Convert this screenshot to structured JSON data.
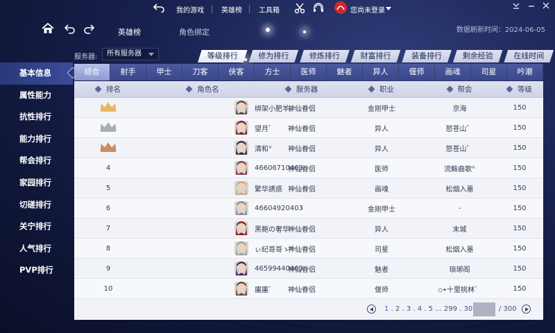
{
  "topbar": {
    "nav": [
      "我的游戏",
      "英雄榜",
      "工具箱"
    ],
    "user_label": "您尚未登录"
  },
  "header": {
    "tabs": [
      "英雄榜",
      "角色绑定"
    ],
    "data_time": "数据刷新时间：2024-06-05"
  },
  "sidebar": {
    "items": [
      "基本信息",
      "属性能力",
      "抗性排行",
      "能力排行",
      "帮会排行",
      "家园排行",
      "切磋排行",
      "关宁排行",
      "人气排行",
      "PVP排行"
    ],
    "active_index": 0
  },
  "server": {
    "label": "服务器:",
    "value": "所有服务器"
  },
  "rank_tabs": [
    "等级排行",
    "修为排行",
    "修炼排行",
    "财富排行",
    "装备排行",
    "剩余经验",
    "在线时间"
  ],
  "class_tabs": [
    "综合",
    "射手",
    "甲士",
    "刀客",
    "侠客",
    "方士",
    "医师",
    "魅者",
    "异人",
    "偃师",
    "画魂",
    "司星",
    "吟潮"
  ],
  "table": {
    "headers": [
      "排名",
      "角色名",
      "服务器",
      "职业",
      "帮会",
      "等级"
    ],
    "rows": [
      {
        "rank": "1",
        "crown": "gold",
        "name": "绑架小肥羊。",
        "server": "神仙眷侣",
        "job": "金刚甲士",
        "guild": "京海",
        "level": "150",
        "avatar": "#5c4a45"
      },
      {
        "rank": "2",
        "crown": "silver",
        "name": "望月゛",
        "server": "神仙眷侣",
        "job": "异人",
        "guild": "怒苍山゛",
        "level": "150",
        "avatar": "#7a1f24"
      },
      {
        "rank": "3",
        "crown": "bronze",
        "name": "清和°",
        "server": "神仙眷侣",
        "job": "异人",
        "guild": "怒苍山゛",
        "level": "150",
        "avatar": "#3b2730"
      },
      {
        "rank": "4",
        "crown": "",
        "name": "46606710403",
        "server": "神仙眷侣",
        "job": "医师",
        "guild": "流觞曲歌°",
        "level": "150",
        "avatar": "#8a3a4a"
      },
      {
        "rank": "5",
        "crown": "",
        "name": "繁华誘惑",
        "server": "神仙眷侣",
        "job": "画魂",
        "guild": "松烟入墨",
        "level": "150",
        "avatar": "#c9a88a"
      },
      {
        "rank": "6",
        "crown": "",
        "name": "46604920403",
        "server": "-",
        "job": "金刚甲士",
        "guild": "-",
        "level": "150",
        "avatar": "#8c8a8f"
      },
      {
        "rank": "7",
        "crown": "",
        "name": "黑鲍の奢华",
        "server": "神仙眷侣",
        "job": "异人",
        "guild": "末城",
        "level": "150",
        "avatar": "#8a1d22"
      },
      {
        "rank": "8",
        "crown": "",
        "name": "ぃ纪哥哥ゝ°",
        "server": "神仙眷侣",
        "job": "司星",
        "guild": "松烟入墨",
        "level": "150",
        "avatar": "#9aa39b"
      },
      {
        "rank": "9",
        "crown": "",
        "name": "46599440403",
        "server": "神仙眷侣",
        "job": "魅者",
        "guild": "琅琊阁",
        "level": "150",
        "avatar": "#4b2450"
      },
      {
        "rank": "10",
        "crown": "",
        "name": "廛廛゛",
        "server": "神仙眷侣",
        "job": "偃师",
        "guild": "⬦•十里桃林゛",
        "level": "150",
        "avatar": "#6b4a3a"
      }
    ]
  },
  "pager": {
    "current": "1",
    "rest": ". 2 . 3 . 4 . 5 ... 299 . 300",
    "total": "/ 300"
  },
  "colors": {
    "bg": "#1a2352",
    "accent": "#3e4c8c",
    "gold": "#e6b76a",
    "silver": "#a9adba",
    "bronze": "#c98e5e"
  }
}
